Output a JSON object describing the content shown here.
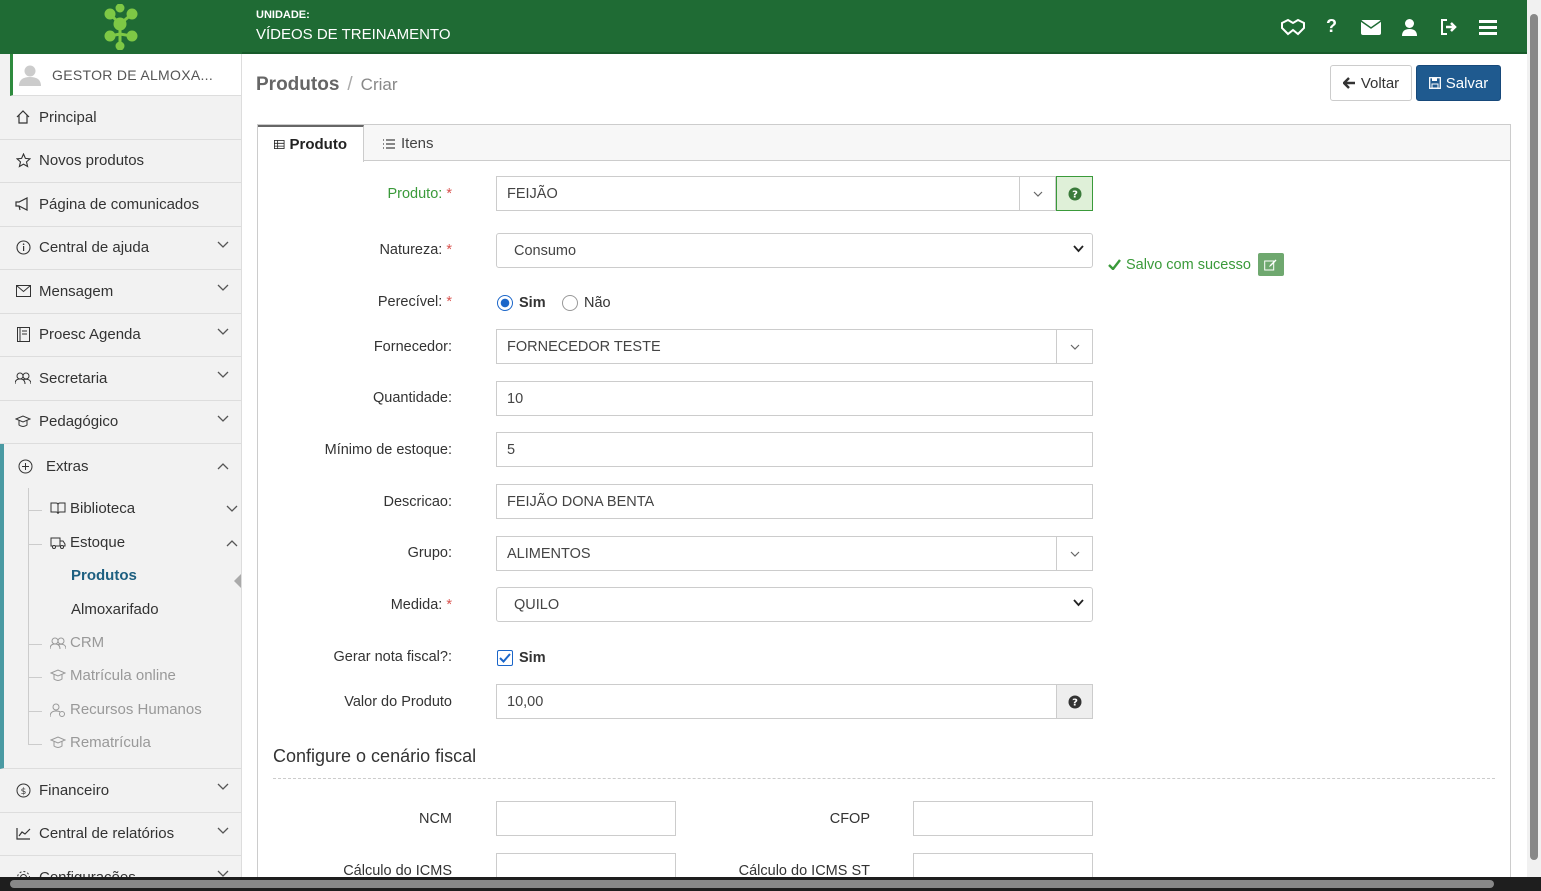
{
  "header": {
    "unit_label": "UNIDADE:",
    "unit_name": "VÍDEOS DE TREINAMENTO",
    "icons": [
      "handshake-icon",
      "question-icon",
      "envelope-icon",
      "user-icon",
      "sign-out-icon",
      "menu-icon"
    ],
    "accent_color": "#1f6b34"
  },
  "sidebar": {
    "user": "GESTOR DE ALMOXA...",
    "items": [
      {
        "label": "Principal",
        "icon": "home-icon"
      },
      {
        "label": "Novos produtos",
        "icon": "star-icon"
      },
      {
        "label": "Página de comunicados",
        "icon": "megaphone-icon"
      },
      {
        "label": "Central de ajuda",
        "icon": "info-icon"
      },
      {
        "label": "Mensagem",
        "icon": "mail-icon"
      },
      {
        "label": "Proesc Agenda",
        "icon": "agenda-icon"
      },
      {
        "label": "Secretaria",
        "icon": "users-icon"
      },
      {
        "label": "Pedagógico",
        "icon": "graduation-icon"
      }
    ],
    "extras": {
      "label": "Extras",
      "biblioteca": "Biblioteca",
      "estoque": "Estoque",
      "produtos": "Produtos",
      "almoxarifado": "Almoxarifado",
      "crm": "CRM",
      "matricula": "Matrícula online",
      "rh": "Recursos Humanos",
      "rematricula": "Rematrícula"
    },
    "bottom_items": [
      {
        "label": "Financeiro",
        "icon": "dollar-icon"
      },
      {
        "label": "Central de relatórios",
        "icon": "chart-icon"
      },
      {
        "label": "Configurações",
        "icon": "gear-icon"
      }
    ]
  },
  "breadcrumb": {
    "section": "Produtos",
    "separator": "/",
    "page": "Criar"
  },
  "actions": {
    "back": "Voltar",
    "save": "Salvar"
  },
  "tabs": [
    {
      "label": "Produto"
    },
    {
      "label": "Itens"
    }
  ],
  "form": {
    "produto": {
      "label": "Produto:",
      "value": "FEIJÃO"
    },
    "success": "Salvo com sucesso",
    "natureza": {
      "label": "Natureza:",
      "value": "Consumo"
    },
    "perecivel": {
      "label": "Perecível:",
      "opt_yes": "Sim",
      "opt_no": "Não",
      "selected": "Sim"
    },
    "fornecedor": {
      "label": "Fornecedor:",
      "value": "FORNECEDOR TESTE"
    },
    "quantidade": {
      "label": "Quantidade:",
      "value": "10"
    },
    "minimo": {
      "label": "Mínimo de estoque:",
      "value": "5"
    },
    "descricao": {
      "label": "Descricao:",
      "value": "FEIJÃO DONA BENTA"
    },
    "grupo": {
      "label": "Grupo:",
      "value": "ALIMENTOS"
    },
    "medida": {
      "label": "Medida:",
      "value": "QUILO"
    },
    "nota": {
      "label": "Gerar nota fiscal?:",
      "check_label": "Sim",
      "checked": true
    },
    "valor": {
      "label": "Valor do Produto",
      "value": "10,00"
    },
    "required_mark": "*"
  },
  "fiscal": {
    "title": "Configure o cenário fiscal",
    "ncm": {
      "label": "NCM",
      "value": ""
    },
    "cfop": {
      "label": "CFOP",
      "value": ""
    },
    "icms": {
      "label": "Cálculo do ICMS",
      "value": ""
    },
    "icms_st": {
      "label": "Cálculo do ICMS ST",
      "value": ""
    }
  }
}
